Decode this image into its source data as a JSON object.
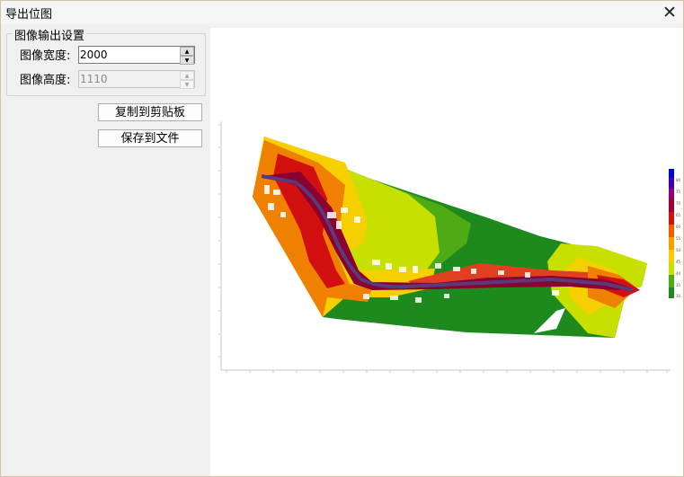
{
  "window": {
    "title": "导出位图",
    "close_glyph": "✕"
  },
  "settings": {
    "group_title": "图像输出设置",
    "width_label": "图像宽度:",
    "width_value": "2000",
    "height_label": "图像高度:",
    "height_value": "1110"
  },
  "buttons": {
    "copy_label": "复制到剪贴板",
    "save_label": "保存到文件"
  },
  "legend": {
    "values": [
      "80",
      "75",
      "70",
      "65",
      "60",
      "55",
      "50",
      "45",
      "40",
      "35",
      "30"
    ]
  },
  "colors": {
    "dark_green": "#1e8a1e",
    "green": "#4fab15",
    "yellow_green": "#c8e000",
    "yellow": "#f5cf00",
    "orange": "#f08000",
    "red": "#d21010",
    "dark_red": "#8a0030",
    "road": "#5a3a7a"
  }
}
